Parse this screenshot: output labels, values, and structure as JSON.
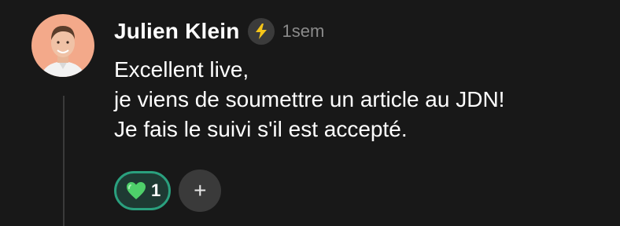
{
  "comment": {
    "author": "Julien Klein",
    "badge_icon": "lightning-icon",
    "timestamp": "1sem",
    "body_lines": [
      "Excellent live,",
      "je viens de soumettre un article au JDN!",
      "Je fais le suivi s'il est accepté."
    ]
  },
  "reactions": [
    {
      "icon": "green-heart-icon",
      "count": "1",
      "selected": true
    }
  ],
  "add_reaction": {
    "icon": "plus-icon",
    "label": "+"
  },
  "colors": {
    "background": "#181818",
    "reaction_border": "#2aa07e",
    "reaction_fill": "#1e3a33",
    "heart": "#4ed06a",
    "badge_bolt": "#f5c518"
  }
}
